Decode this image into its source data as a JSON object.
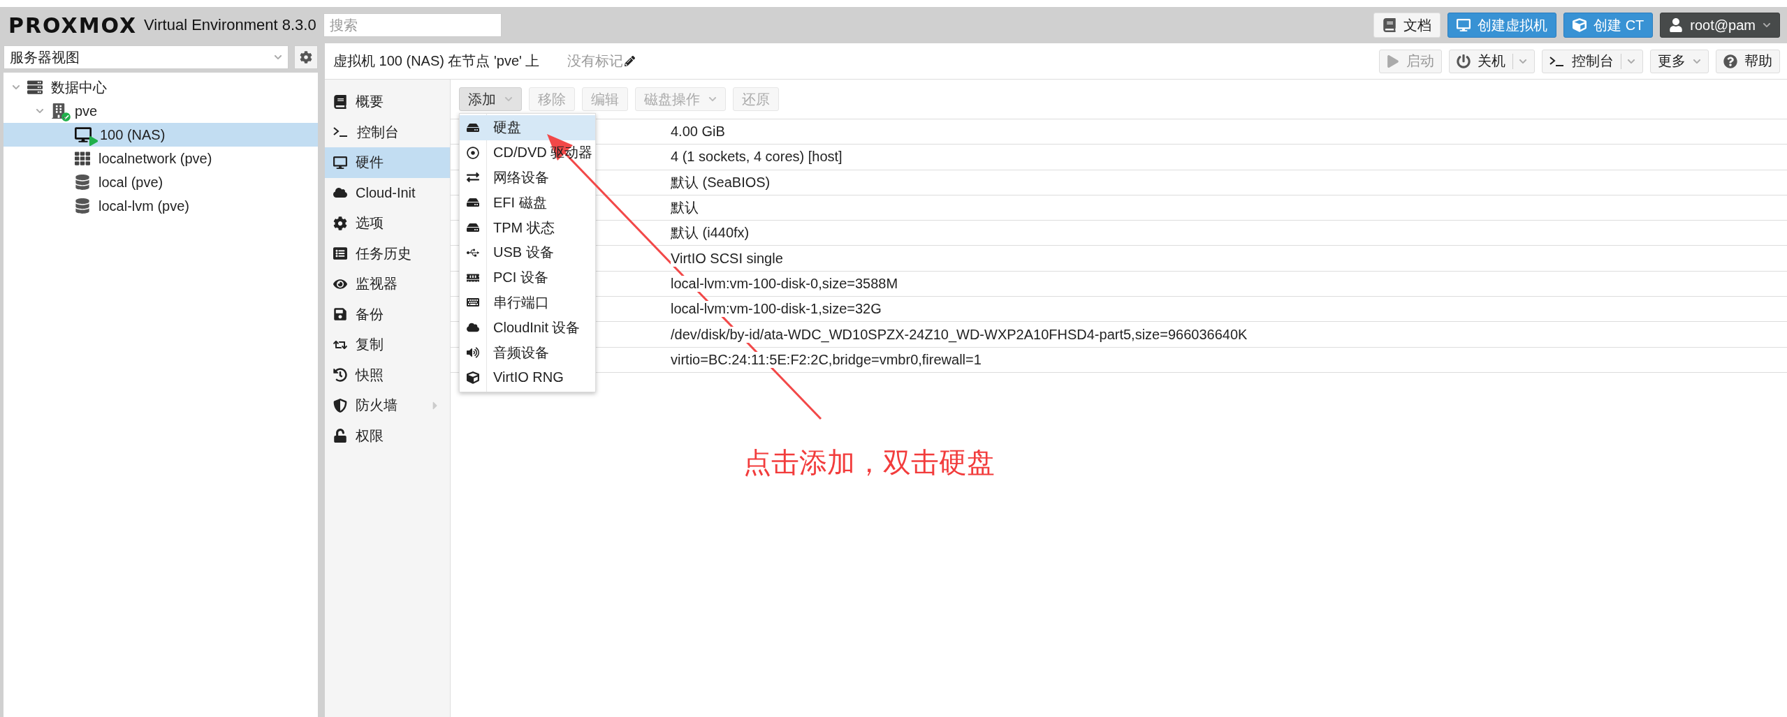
{
  "header": {
    "logo": "PROXMOX",
    "version": "Virtual Environment 8.3.0",
    "search": {
      "placeholder": "搜索"
    },
    "buttons": [
      {
        "label": "文档",
        "kind": "docs"
      },
      {
        "label": "创建虚拟机",
        "kind": "vm"
      },
      {
        "label": "创建 CT",
        "kind": "ct"
      },
      {
        "label": "root@pam",
        "kind": "user"
      }
    ]
  },
  "sidebar": {
    "view": "服务器视图",
    "tree": [
      {
        "label": "数据中心",
        "kind": "datacenter",
        "expanded": true,
        "selected": false,
        "children": [
          {
            "label": "pve",
            "kind": "node",
            "expanded": true,
            "selected": false,
            "children": [
              {
                "label": "100 (NAS)",
                "kind": "vm",
                "selected": true
              },
              {
                "label": "localnetwork (pve)",
                "kind": "sdn",
                "selected": false
              },
              {
                "label": "local (pve)",
                "kind": "storage",
                "selected": false
              },
              {
                "label": "local-lvm (pve)",
                "kind": "storage",
                "selected": false
              }
            ]
          }
        ]
      }
    ]
  },
  "vm_header": {
    "title": "虚拟机 100 (NAS) 在节点 'pve' 上",
    "tags": "没有标记",
    "buttons": [
      {
        "label": "启动",
        "kind": "start",
        "disabled": true
      },
      {
        "label": "关机",
        "kind": "shutdown",
        "disabled": false
      },
      {
        "label": "控制台",
        "kind": "console",
        "disabled": false
      },
      {
        "label": "更多",
        "kind": "more",
        "disabled": false
      },
      {
        "label": "帮助",
        "kind": "help",
        "disabled": false
      }
    ]
  },
  "nav": [
    {
      "label": "概要",
      "selected": false
    },
    {
      "label": "控制台",
      "selected": false
    },
    {
      "label": "硬件",
      "selected": true
    },
    {
      "label": "Cloud-Init",
      "selected": false
    },
    {
      "label": "选项",
      "selected": false
    },
    {
      "label": "任务历史",
      "selected": false
    },
    {
      "label": "监视器",
      "selected": false
    },
    {
      "label": "备份",
      "selected": false
    },
    {
      "label": "复制",
      "selected": false
    },
    {
      "label": "快照",
      "selected": false
    },
    {
      "label": "防火墙",
      "selected": false,
      "has_submenu": true
    },
    {
      "label": "权限",
      "selected": false
    }
  ],
  "toolbar": [
    {
      "label": "添加",
      "disabled": false,
      "dropdown": true
    },
    {
      "label": "移除",
      "disabled": true,
      "dropdown": false
    },
    {
      "label": "编辑",
      "disabled": true,
      "dropdown": false
    },
    {
      "label": "磁盘操作",
      "disabled": true,
      "dropdown": true
    },
    {
      "label": "还原",
      "disabled": true,
      "dropdown": false
    }
  ],
  "add_menu": [
    {
      "label": "硬盘",
      "selected": true
    },
    {
      "label": "CD/DVD 驱动器",
      "selected": false
    },
    {
      "label": "网络设备",
      "selected": false
    },
    {
      "label": "EFI 磁盘",
      "selected": false
    },
    {
      "label": "TPM 状态",
      "selected": false
    },
    {
      "label": "USB 设备",
      "selected": false
    },
    {
      "label": "PCI 设备",
      "selected": false
    },
    {
      "label": "串行端口",
      "selected": false
    },
    {
      "label": "CloudInit 设备",
      "selected": false
    },
    {
      "label": "音频设备",
      "selected": false
    },
    {
      "label": "VirtIO RNG",
      "selected": false
    }
  ],
  "hardware_rows": [
    "4.00 GiB",
    "4 (1 sockets, 4 cores) [host]",
    "默认 (SeaBIOS)",
    "默认",
    "默认 (i440fx)",
    "VirtIO SCSI single",
    "local-lvm:vm-100-disk-0,size=3588M",
    "local-lvm:vm-100-disk-1,size=32G",
    "/dev/disk/by-id/ata-WDC_WD10SPZX-24Z10_WD-WXP2A10FHSD4-part5,size=966036640K",
    "virtio=BC:24:11:5E:F2:2C,bridge=vmbr0,firewall=1"
  ],
  "annotation": "点击添加，双击硬盘"
}
